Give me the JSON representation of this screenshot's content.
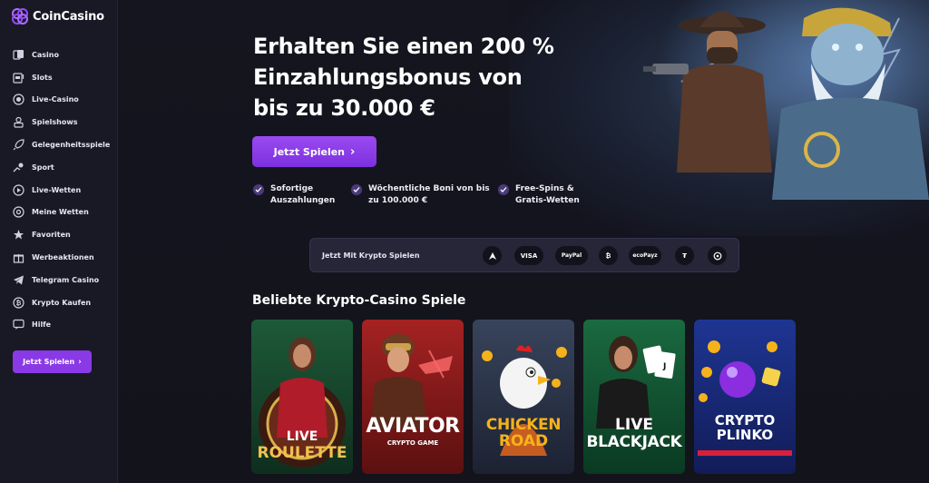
{
  "brand": {
    "name": "CoinCasino"
  },
  "sidebar": {
    "items": [
      {
        "label": "Casino",
        "icon": "cards-icon"
      },
      {
        "label": "Slots",
        "icon": "slot-machine-icon"
      },
      {
        "label": "Live-Casino",
        "icon": "live-chip-icon"
      },
      {
        "label": "Spielshows",
        "icon": "game-show-icon"
      },
      {
        "label": "Gelegenheitsspiele",
        "icon": "rocket-icon"
      },
      {
        "label": "Sport",
        "icon": "sport-icon"
      },
      {
        "label": "Live-Wetten",
        "icon": "play-circle-icon"
      },
      {
        "label": "Meine Wetten",
        "icon": "bets-icon"
      },
      {
        "label": "Favoriten",
        "icon": "star-icon"
      },
      {
        "label": "Werbeaktionen",
        "icon": "gift-icon"
      },
      {
        "label": "Telegram Casino",
        "icon": "telegram-icon"
      },
      {
        "label": "Krypto Kaufen",
        "icon": "crypto-buy-icon"
      },
      {
        "label": "Hilfe",
        "icon": "help-chat-icon"
      }
    ],
    "cta_label": "Jetzt Spielen"
  },
  "hero": {
    "title": "Erhalten Sie einen 200 % Einzahlungsbonus von bis zu 30.000 €",
    "cta_label": "Jetzt Spielen",
    "benefits": [
      {
        "text": "Sofortige\nAuszahlungen"
      },
      {
        "text": "Wöchentliche Boni von bis\nzu 100.000 €"
      },
      {
        "text": "Free-Spins &\nGratis-Wetten"
      }
    ]
  },
  "crypto_bar": {
    "label": "Jetzt Mit Krypto Spielen",
    "methods": [
      {
        "label": "",
        "icon": "arrow-logo-icon"
      },
      {
        "label": "VISA",
        "icon": "visa-icon"
      },
      {
        "label": "PayPal",
        "icon": "paypal-icon"
      },
      {
        "label": "",
        "icon": "bitcoin-icon"
      },
      {
        "label": "ecoPayz",
        "icon": "ecopayz-icon"
      },
      {
        "label": "",
        "icon": "tether-icon"
      },
      {
        "label": "",
        "icon": "solana-icon"
      }
    ]
  },
  "games": {
    "section_title": "Beliebte Krypto-Casino Spiele",
    "cards": [
      {
        "line1": "LIVE",
        "line2": "ROULETTE",
        "sub": "",
        "bg": "#14402a",
        "accent": "#f2c14e"
      },
      {
        "line1": "AVIATOR",
        "line2": "",
        "sub": "CRYPTO GAME",
        "bg": "#8a1d1d",
        "accent": "#ffffff"
      },
      {
        "line1": "CHICKEN",
        "line2": "ROAD",
        "sub": "",
        "bg": "#2b3446",
        "accent": "#f6b21b"
      },
      {
        "line1": "LIVE",
        "line2": "BLACKJACK",
        "sub": "",
        "bg": "#0f4a2e",
        "accent": "#ffffff"
      },
      {
        "line1": "CRYPTO",
        "line2": "PLINKO",
        "sub": "",
        "bg": "#1a2b7a",
        "accent": "#ffffff"
      }
    ]
  },
  "colors": {
    "accent": "#8a39e6",
    "sidebar_bg": "#191926",
    "page_bg": "#141420"
  }
}
